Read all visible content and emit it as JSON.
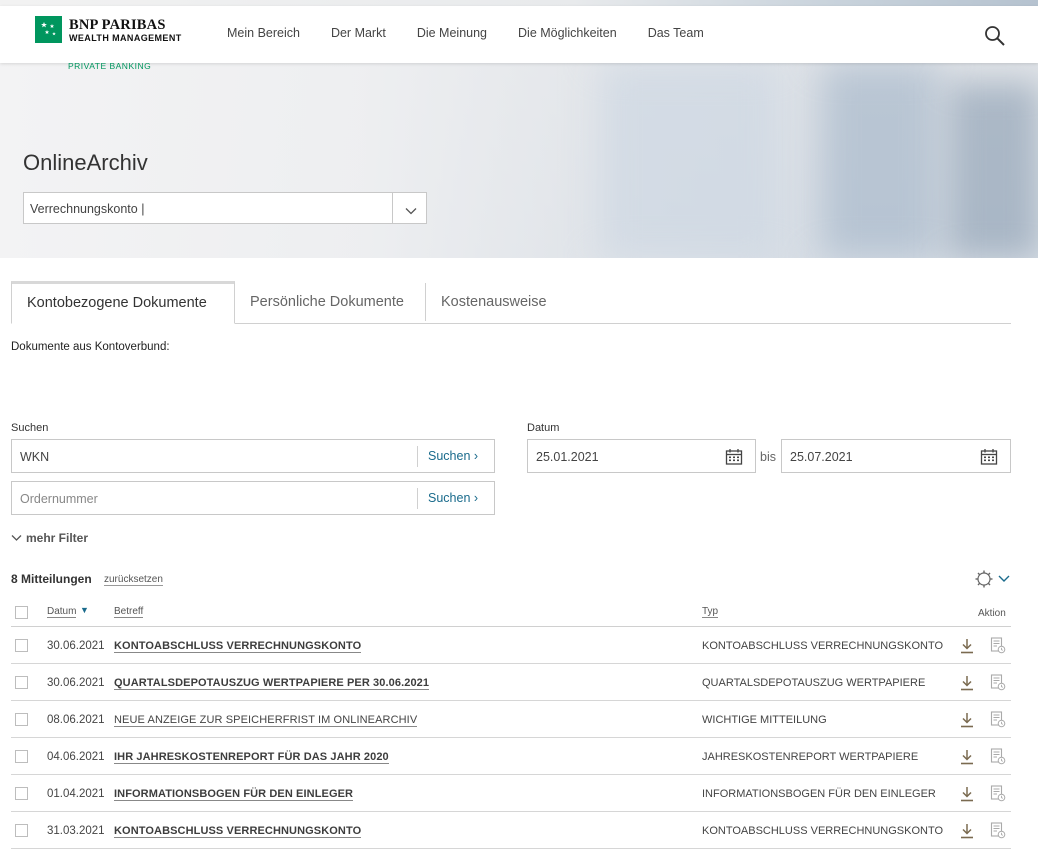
{
  "header": {
    "logo_line1": "BNP PARIBAS",
    "logo_line2": "WEALTH MANAGEMENT",
    "logo_line3": "PRIVATE BANKING",
    "nav": [
      "Mein Bereich",
      "Der Markt",
      "Die Meinung",
      "Die Möglichkeiten",
      "Das Team"
    ],
    "search_icon": "search-icon"
  },
  "hero": {
    "title": "OnlineArchiv",
    "account_select": "Verrechnungskonto |"
  },
  "tabs": [
    "Kontobezogene Dokumente",
    "Persönliche Dokumente",
    "Kostenausweise"
  ],
  "active_tab": "Kontobezogene Dokumente",
  "kontoverbund_label": "Dokumente aus Kontoverbund:",
  "filters": {
    "search_label": "Suchen",
    "wkn_value": "WKN",
    "order_placeholder": "Ordernummer",
    "search_button": "Suchen",
    "date_label": "Datum",
    "date_from": "25.01.2021",
    "date_to": "25.07.2021",
    "bis": "bis",
    "more_filter": "mehr Filter"
  },
  "results": {
    "count_label": "8 Mitteilungen",
    "reset_label": "zurücksetzen"
  },
  "table": {
    "headers": {
      "datum": "Datum",
      "betreff": "Betreff",
      "typ": "Typ",
      "aktion": "Aktion"
    },
    "rows": [
      {
        "date": "30.06.2021",
        "subject": "KONTOABSCHLUSS VERRECHNUNGSKONTO",
        "bold": true,
        "type": "KONTOABSCHLUSS VERRECHNUNGSKONTO"
      },
      {
        "date": "30.06.2021",
        "subject": "QUARTALSDEPOTAUSZUG WERTPAPIERE PER 30.06.2021",
        "bold": true,
        "type": "QUARTALSDEPOTAUSZUG WERTPAPIERE"
      },
      {
        "date": "08.06.2021",
        "subject": "NEUE ANZEIGE ZUR SPEICHERFRIST IM ONLINEARCHIV",
        "bold": false,
        "type": "WICHTIGE MITTEILUNG"
      },
      {
        "date": "04.06.2021",
        "subject": "IHR JAHRESKOSTENREPORT FÜR DAS JAHR 2020",
        "bold": true,
        "type": "JAHRESKOSTENREPORT WERTPAPIERE"
      },
      {
        "date": "01.04.2021",
        "subject": "INFORMATIONSBOGEN FÜR DEN EINLEGER",
        "bold": true,
        "type": "INFORMATIONSBOGEN FÜR DEN EINLEGER"
      },
      {
        "date": "31.03.2021",
        "subject": "KONTOABSCHLUSS VERRECHNUNGSKONTO",
        "bold": true,
        "type": "KONTOABSCHLUSS VERRECHNUNGSKONTO"
      }
    ]
  },
  "colors": {
    "brand_green": "#00965e",
    "link_blue": "#1a6b8c"
  }
}
